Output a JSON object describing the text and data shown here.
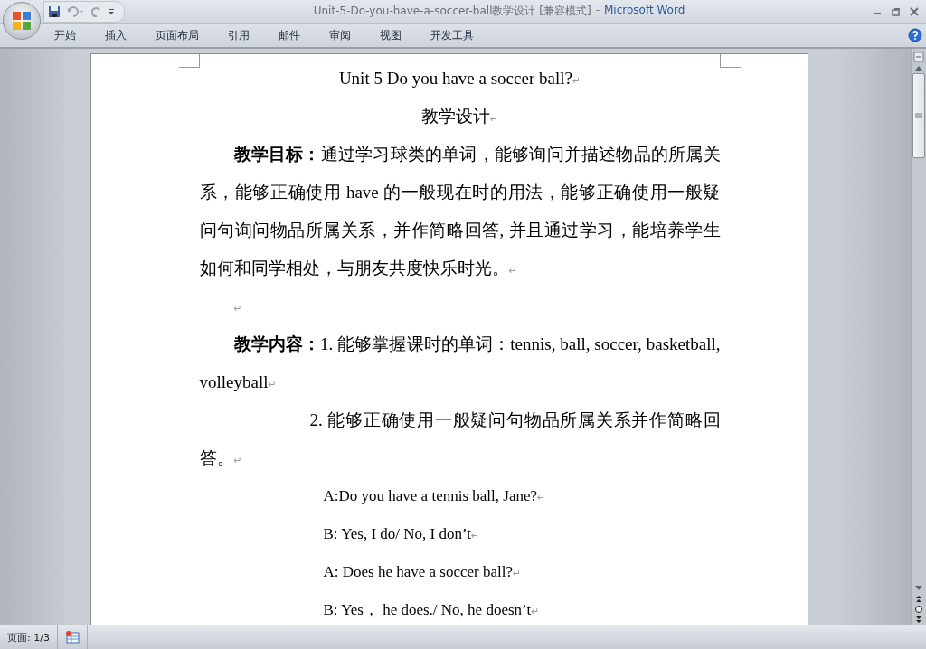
{
  "window": {
    "title": "Unit-5-Do-you-have-a-soccer-ball教学设计 [兼容模式]",
    "separator": "-",
    "app": "Microsoft Word"
  },
  "ribbon_tabs": [
    {
      "label": "开始",
      "selected": false
    },
    {
      "label": "插入",
      "selected": false
    },
    {
      "label": "页面布局",
      "selected": false
    },
    {
      "label": "引用",
      "selected": false
    },
    {
      "label": "邮件",
      "selected": false
    },
    {
      "label": "审阅",
      "selected": false
    },
    {
      "label": "视图",
      "selected": false
    },
    {
      "label": "开发工具",
      "selected": false
    }
  ],
  "document": {
    "paragraphs": [
      {
        "kind": "title",
        "text": "Unit 5 Do you have a soccer ball?",
        "mark": "↵"
      },
      {
        "kind": "center",
        "text": "教学设计",
        "mark": "↵"
      },
      {
        "kind": "body",
        "text": "**教学目标：**通过学习球类的单词，能够询问并描述物品的所属关系，能够正确使用 have 的一般现在时的用法，能够正确使用一般疑问句询问物品所属关系，并作简略回答, 并且通过学习，能培养学生如何和同学相处，与朋友共度快乐时光。",
        "mark": "↵"
      },
      {
        "kind": "empty",
        "mark": "↵"
      },
      {
        "kind": "body",
        "text": "**教学内容：**1. 能够掌握课时的单词：tennis, ball, soccer, basketball, volleyball",
        "mark": "↵"
      },
      {
        "kind": "hanging",
        "text": "2. 能够正确使用一般疑问句物品所属关系并作简略回答。",
        "mark": "↵"
      },
      {
        "kind": "dialog",
        "text": "A:Do you have a tennis ball, Jane?",
        "mark": "↵"
      },
      {
        "kind": "dialog",
        "text": " B: Yes, I do/ No, I don’t",
        "mark": "↵"
      },
      {
        "kind": "dialog",
        "text": " A: Does he have a soccer ball?",
        "mark": "↵"
      },
      {
        "kind": "dialog",
        "text": " B: Yes， he does./ No, he doesn’t",
        "mark": "↵"
      }
    ]
  },
  "status_bar": {
    "page": "页面: 1/3"
  }
}
